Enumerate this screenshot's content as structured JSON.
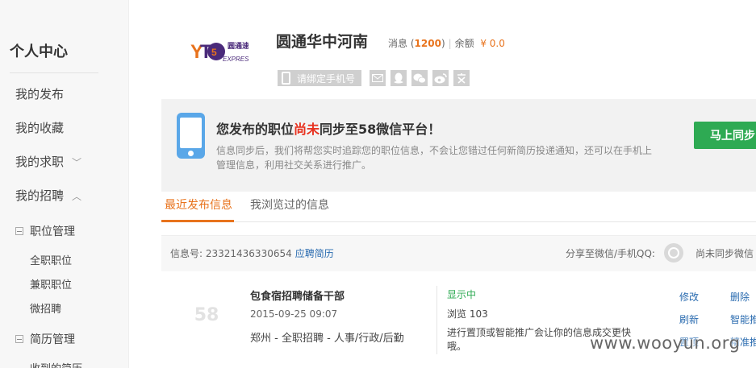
{
  "sidebar": {
    "title": "个人中心",
    "items": [
      {
        "label": "我的发布"
      },
      {
        "label": "我的收藏"
      },
      {
        "label": "我的求职",
        "chevron": "﹀"
      },
      {
        "label": "我的招聘",
        "chevron": "︿"
      }
    ],
    "groups": [
      {
        "label": "职位管理",
        "subitems": [
          "全职职位",
          "兼职职位",
          "微招聘"
        ]
      },
      {
        "label": "简历管理",
        "subitems": [
          "收到的简历"
        ]
      }
    ]
  },
  "header": {
    "logo_text": "圆通速递",
    "logo_sub": "EXPRESS",
    "company": "圆通华中河南",
    "msg_label": "消息",
    "msg_paren_open": "(",
    "msg_count": "1200",
    "msg_paren_close": ")",
    "balance_label": "余额",
    "balance_value": "¥ 0.0",
    "bind_phone": "请绑定手机号",
    "social_icons": [
      "mail-icon",
      "qq-icon",
      "wechat-icon",
      "weibo-icon",
      "id-card-icon"
    ]
  },
  "banner": {
    "title_pre": "您发布的职位",
    "title_red": "尚未",
    "title_post": "同步至58微信平台！",
    "desc": "信息同步后，我们将帮您实时追踪您的职位信息，不会让您错过任何新简历投递通知，还可以在手机上管理信息，利用社交关系进行推广。",
    "button": "马上同步"
  },
  "tabs": [
    {
      "label": "最近发布信息",
      "active": true
    },
    {
      "label": "我浏览过的信息",
      "active": false
    }
  ],
  "infobar": {
    "id_label": "信息号: 23321436330654",
    "apply_link": "应聘简历",
    "share": "分享至微信/手机QQ:",
    "not_sync": "尚未同步微信"
  },
  "job": {
    "logo": "58",
    "title": "包食宿招聘储备干部",
    "date": "2015-09-25 09:07",
    "meta": "郑州 - 全职招聘 - 人事/行政/后勤",
    "status": "显示中",
    "views": "浏览 103",
    "tip": "进行置顶或智能推广会让你的信息成交更快哦。",
    "actions": [
      "修改",
      "删除",
      "刷新",
      "智能推",
      "置顶",
      "精准推"
    ]
  },
  "watermark": "www.wooyun.org",
  "colors": {
    "accent": "#e8731d",
    "green": "#2eaa53",
    "link": "#2b6cb0",
    "red": "#e8311f"
  }
}
